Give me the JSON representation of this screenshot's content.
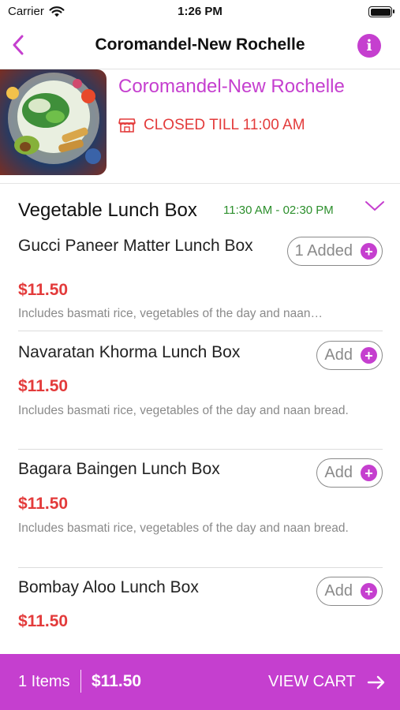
{
  "status_bar": {
    "carrier": "Carrier",
    "time": "1:26 PM"
  },
  "nav": {
    "title": "Coromandel-New Rochelle"
  },
  "restaurant": {
    "name": "Coromandel-New Rochelle",
    "status": "CLOSED TILL 11:00 AM"
  },
  "section": {
    "title": "Vegetable Lunch Box",
    "hours": "11:30 AM - 02:30 PM"
  },
  "items": [
    {
      "name": "Gucci Paneer Matter Lunch Box",
      "price": "$11.50",
      "description": "Includes basmati rice, vegetables of the day and naan…",
      "button": "1 Added"
    },
    {
      "name": "Navaratan Khorma Lunch Box",
      "price": "$11.50",
      "description": "Includes basmati rice, vegetables of the day and naan bread.",
      "button": "Add"
    },
    {
      "name": "Bagara Baingen Lunch Box",
      "price": "$11.50",
      "description": "Includes basmati rice, vegetables of the day and naan bread.",
      "button": "Add"
    },
    {
      "name": "Bombay Aloo Lunch Box",
      "price": "$11.50",
      "description": "",
      "button": "Add"
    }
  ],
  "cart": {
    "count": "1 Items",
    "total": "$11.50",
    "view_cart": "VIEW CART"
  },
  "icons": {
    "back": "chevron-left-icon",
    "info": "info-icon",
    "store": "store-icon",
    "collapse": "chevron-down-icon",
    "add": "plus-icon",
    "arrow": "arrow-right-icon"
  },
  "colors": {
    "accent": "#c53fcf",
    "price": "#e33b3b",
    "hours": "#2c8f2c",
    "closed": "#e33b3b"
  }
}
